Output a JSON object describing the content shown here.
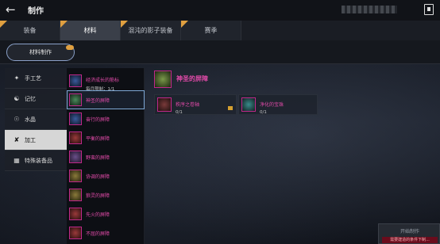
{
  "header": {
    "title": "制作"
  },
  "tabs": [
    {
      "label": "装备"
    },
    {
      "label": "材料"
    },
    {
      "label": "混沌的影子装备"
    },
    {
      "label": "赛季"
    }
  ],
  "subtab": {
    "label": "材料制作"
  },
  "categories": [
    {
      "label": "手工艺",
      "icon": "hammer-icon"
    },
    {
      "label": "记忆",
      "icon": "memory-icon"
    },
    {
      "label": "水晶",
      "icon": "crystal-icon"
    },
    {
      "label": "加工",
      "icon": "process-icon"
    },
    {
      "label": "特殊装备品",
      "icon": "special-icon"
    }
  ],
  "items": [
    {
      "label": "经济成长的筋标",
      "sub": "每月限制：1/1"
    },
    {
      "label": "神圣的屏障"
    },
    {
      "label": "奋行的屏障"
    },
    {
      "label": "平衡的屏障"
    },
    {
      "label": "野蛮的屏障"
    },
    {
      "label": "协调的屏障"
    },
    {
      "label": "狼灵的屏障"
    },
    {
      "label": "先火的屏障"
    },
    {
      "label": "不屈的屏障"
    }
  ],
  "detail": {
    "title": "神圣的屏障",
    "materials": [
      {
        "name": "秩序之卷轴",
        "count": "0/1"
      },
      {
        "name": "净化的宝珠",
        "count": "0/1"
      }
    ]
  },
  "craft": {
    "label": "开始制作",
    "warning": "需要建造的条件下制..."
  },
  "colors": {
    "accent": "#e04aa8",
    "badge": "#e0a040",
    "highlight": "#7fa9d6"
  }
}
